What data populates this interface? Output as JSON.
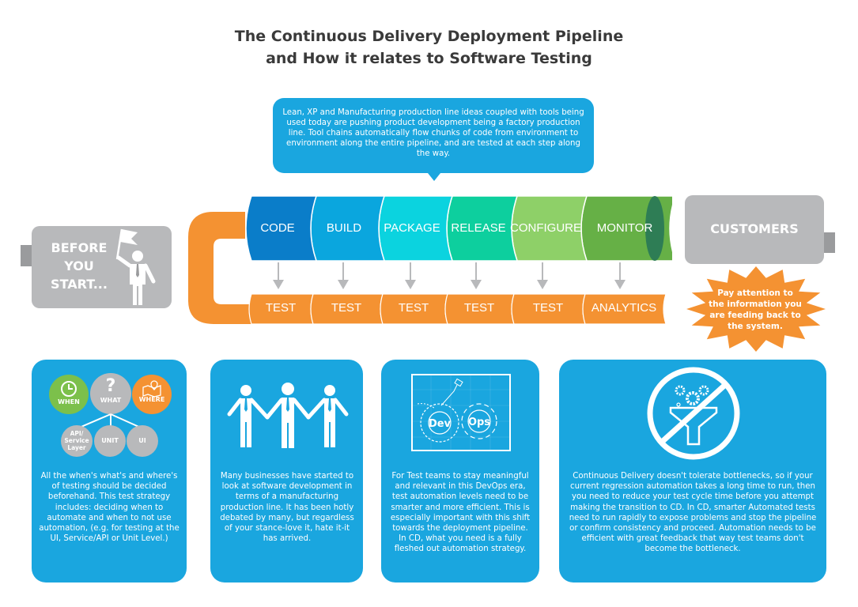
{
  "title": {
    "line1": "The Continuous Delivery Deployment Pipeline",
    "line2": "and How it relates to Software Testing"
  },
  "intro": "Lean, XP and Manufacturing production line ideas coupled with tools being used today are pushing product development being a factory production line. Tool chains automatically flow chunks of code from environment to environment along the entire pipeline, and are tested at each step along the way.",
  "before": {
    "line1": "BEFORE",
    "line2": "YOU",
    "line3": "START..."
  },
  "customers": {
    "label": "CUSTOMERS",
    "callout": "Pay attention to the information you are feeding back to the system."
  },
  "pipeline": {
    "stages": [
      {
        "label": "CODE",
        "color": "#0a7dc9",
        "output": "TEST"
      },
      {
        "label": "BUILD",
        "color": "#0aa6de",
        "output": "TEST"
      },
      {
        "label": "PACKAGE",
        "color": "#0bd3df",
        "output": "TEST"
      },
      {
        "label": "RELEASE",
        "color": "#0dcf9e",
        "output": "TEST"
      },
      {
        "label": "CONFIGURE",
        "color": "#8ed068",
        "output": "TEST"
      },
      {
        "label": "MONITOR",
        "color": "#66b046",
        "output": "ANALYTICS"
      }
    ],
    "loop_color": "#f49232",
    "cap_color": "#2e7d55"
  },
  "cards": [
    {
      "icon": "strategy-circles",
      "circles": {
        "when": "WHEN",
        "what": "WHAT",
        "where": "WHERE",
        "api": "API/ Service Layer",
        "unit": "UNIT",
        "ui": "UI"
      },
      "text": "All the when's what's and where's of testing should be decided beforehand. This test strategy includes: deciding when to automate and when to not use automation, (e.g. for testing at the UI, Service/API or Unit Level.)"
    },
    {
      "icon": "team-people",
      "text": "Many businesses have started to look at software development in terms of a manufacturing production line. It has been hotly debated by many, but regardless of your stance-love it, hate it-it has arrived."
    },
    {
      "icon": "devops-gears",
      "gear_labels": {
        "dev": "Dev",
        "ops": "Ops"
      },
      "text": "For Test teams to stay meaningful and relevant in this DevOps era, test automation levels need to be smarter and more efficient. This is especially important with this shift towards the deployment pipeline. In CD, what you need is a fully fleshed out automation strategy."
    },
    {
      "icon": "no-bottleneck-funnel",
      "text": "Continuous Delivery doesn't tolerate bottlenecks, so if your current regression automation takes a long time to run, then you need to reduce your test cycle time before you attempt making the transition to CD. In CD, smarter Automated tests need to run rapidly to expose problems and stop the pipeline or confirm consistency and proceed. Automation needs to be efficient with great feedback that way test teams don't become the bottleneck."
    }
  ],
  "colors": {
    "accent_blue": "#1aa6df",
    "orange": "#f49232",
    "grey": "#b8b9bb",
    "green": "#7cc04b"
  }
}
